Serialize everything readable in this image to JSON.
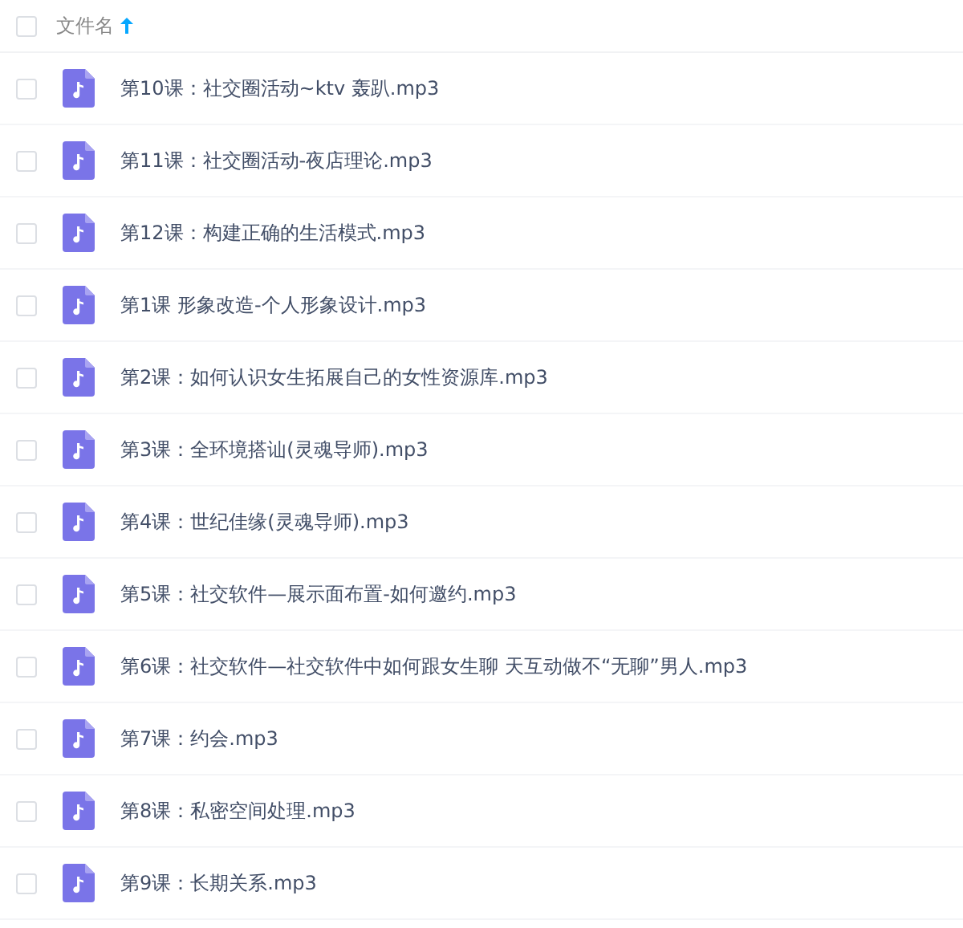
{
  "header": {
    "checked": false,
    "column": "文件名",
    "sort_ascending": true
  },
  "files": [
    {
      "name": "第10课：社交圈活动~ktv 轰趴.mp3",
      "checked": false
    },
    {
      "name": "第11课：社交圈活动-夜店理论.mp3",
      "checked": false
    },
    {
      "name": "第12课：构建正确的生活模式.mp3",
      "checked": false
    },
    {
      "name": "第1课 形象改造-个人形象设计.mp3",
      "checked": false
    },
    {
      "name": "第2课：如何认识女生拓展自己的女性资源库.mp3",
      "checked": false
    },
    {
      "name": "第3课：全环境搭讪(灵魂导师).mp3",
      "checked": false
    },
    {
      "name": "第4课：世纪佳缘(灵魂导师).mp3",
      "checked": false
    },
    {
      "name": "第5课：社交软件—展示面布置-如何邀约.mp3",
      "checked": false
    },
    {
      "name": "第6课：社交软件—社交软件中如何跟女生聊 天互动做不“无聊”男人.mp3",
      "checked": false
    },
    {
      "name": "第7课：约会.mp3",
      "checked": false
    },
    {
      "name": "第8课：私密空间处理.mp3",
      "checked": false
    },
    {
      "name": "第9课：长期关系.mp3",
      "checked": false
    }
  ]
}
